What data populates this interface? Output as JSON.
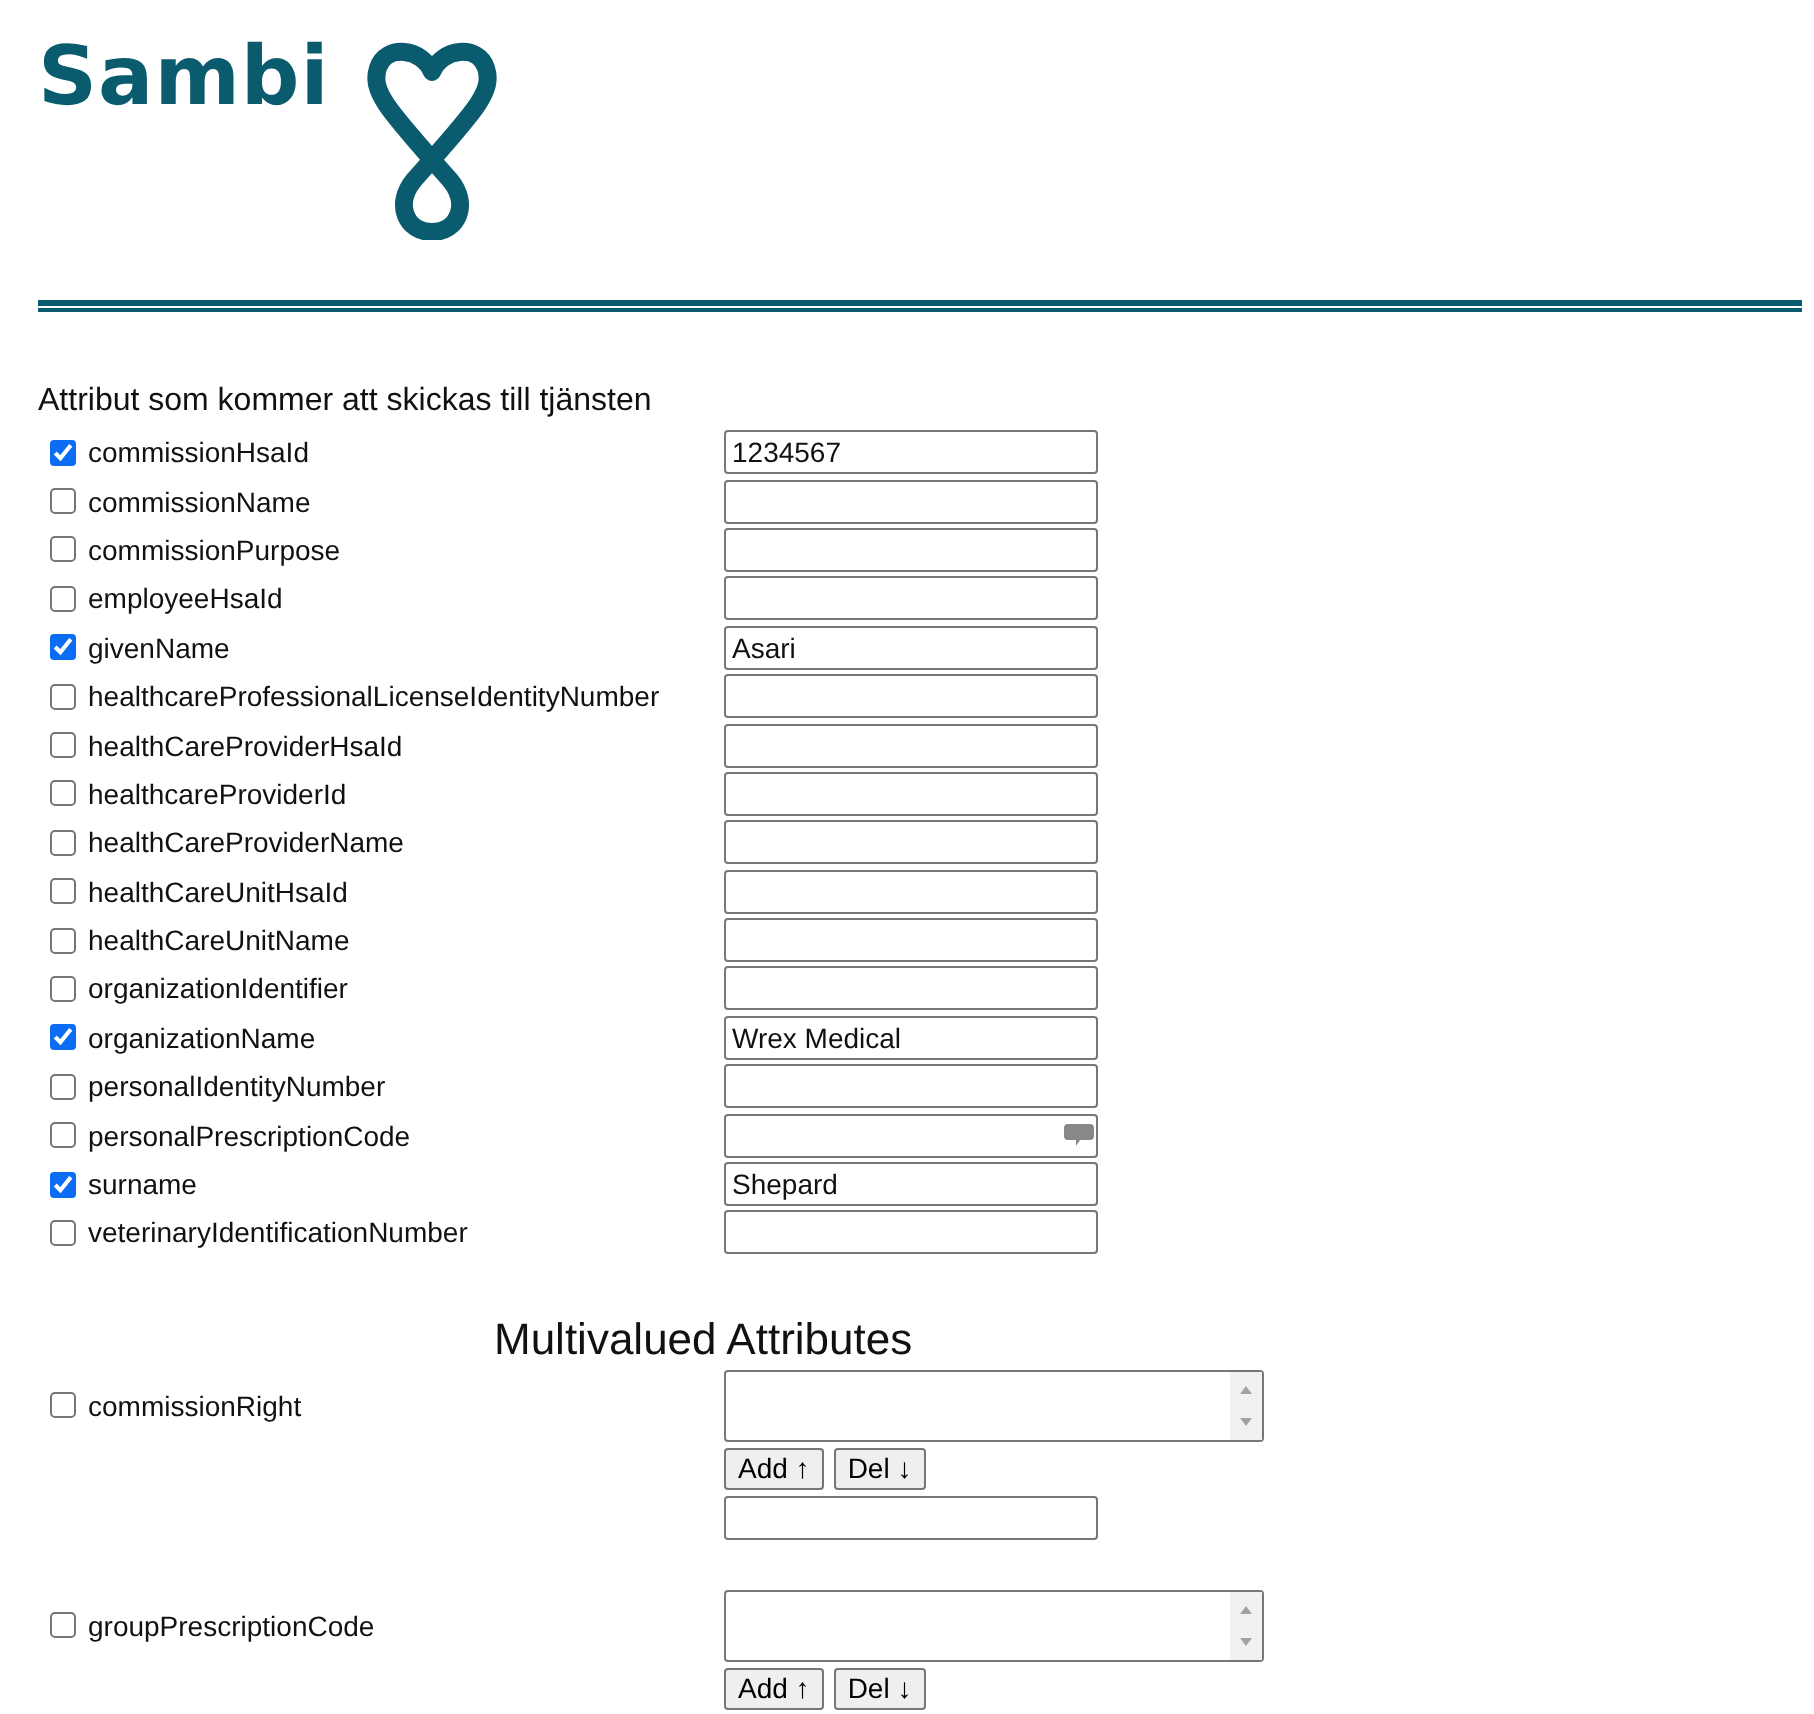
{
  "logo": {
    "text": "Sambi"
  },
  "attributes": {
    "heading": "Attribut som kommer att skickas till tjänsten",
    "rows": [
      {
        "label": "commissionHsaId",
        "checked": true,
        "value": "1234567",
        "kind": "plain"
      },
      {
        "label": "commissionName",
        "checked": false,
        "kind": "plain"
      },
      {
        "label": "commissionPurpose",
        "checked": false,
        "kind": "plain"
      },
      {
        "label": "employeeHsaId",
        "checked": false,
        "kind": "plain"
      },
      {
        "label": "givenName",
        "checked": true,
        "value": "Asari",
        "kind": "plain"
      },
      {
        "label": "healthcareProfessionalLicenseIdentityNumber",
        "checked": false,
        "kind": "plain"
      },
      {
        "label": "healthCareProviderHsaId",
        "checked": false,
        "kind": "plain"
      },
      {
        "label": "healthcareProviderId",
        "checked": false,
        "kind": "plain"
      },
      {
        "label": "healthCareProviderName",
        "checked": false,
        "kind": "plain"
      },
      {
        "label": "healthCareUnitHsaId",
        "checked": false,
        "kind": "plain"
      },
      {
        "label": "healthCareUnitName",
        "checked": false,
        "kind": "plain"
      },
      {
        "label": "organizationIdentifier",
        "checked": false,
        "kind": "plain"
      },
      {
        "label": "organizationName",
        "checked": true,
        "value": "Wrex Medical",
        "kind": "plain"
      },
      {
        "label": "personalIdentityNumber",
        "checked": false,
        "kind": "plain"
      },
      {
        "label": "personalPrescriptionCode",
        "checked": false,
        "kind": "with_icon"
      },
      {
        "label": "surname",
        "checked": true,
        "value": "Shepard",
        "kind": "plain"
      },
      {
        "label": "veterinaryIdentificationNumber",
        "checked": false,
        "kind": "plain"
      }
    ]
  },
  "multivalued": {
    "heading": "Multivalued Attributes",
    "groups": [
      {
        "label": "commissionRight",
        "checked": false,
        "add_button": "Add ↑",
        "del_button": "Del ↓",
        "new_value_field": true
      },
      {
        "label": "groupPrescriptionCode",
        "checked": false,
        "add_button": "Add ↑",
        "del_button": "Del ↓",
        "new_value_field": false
      }
    ]
  }
}
